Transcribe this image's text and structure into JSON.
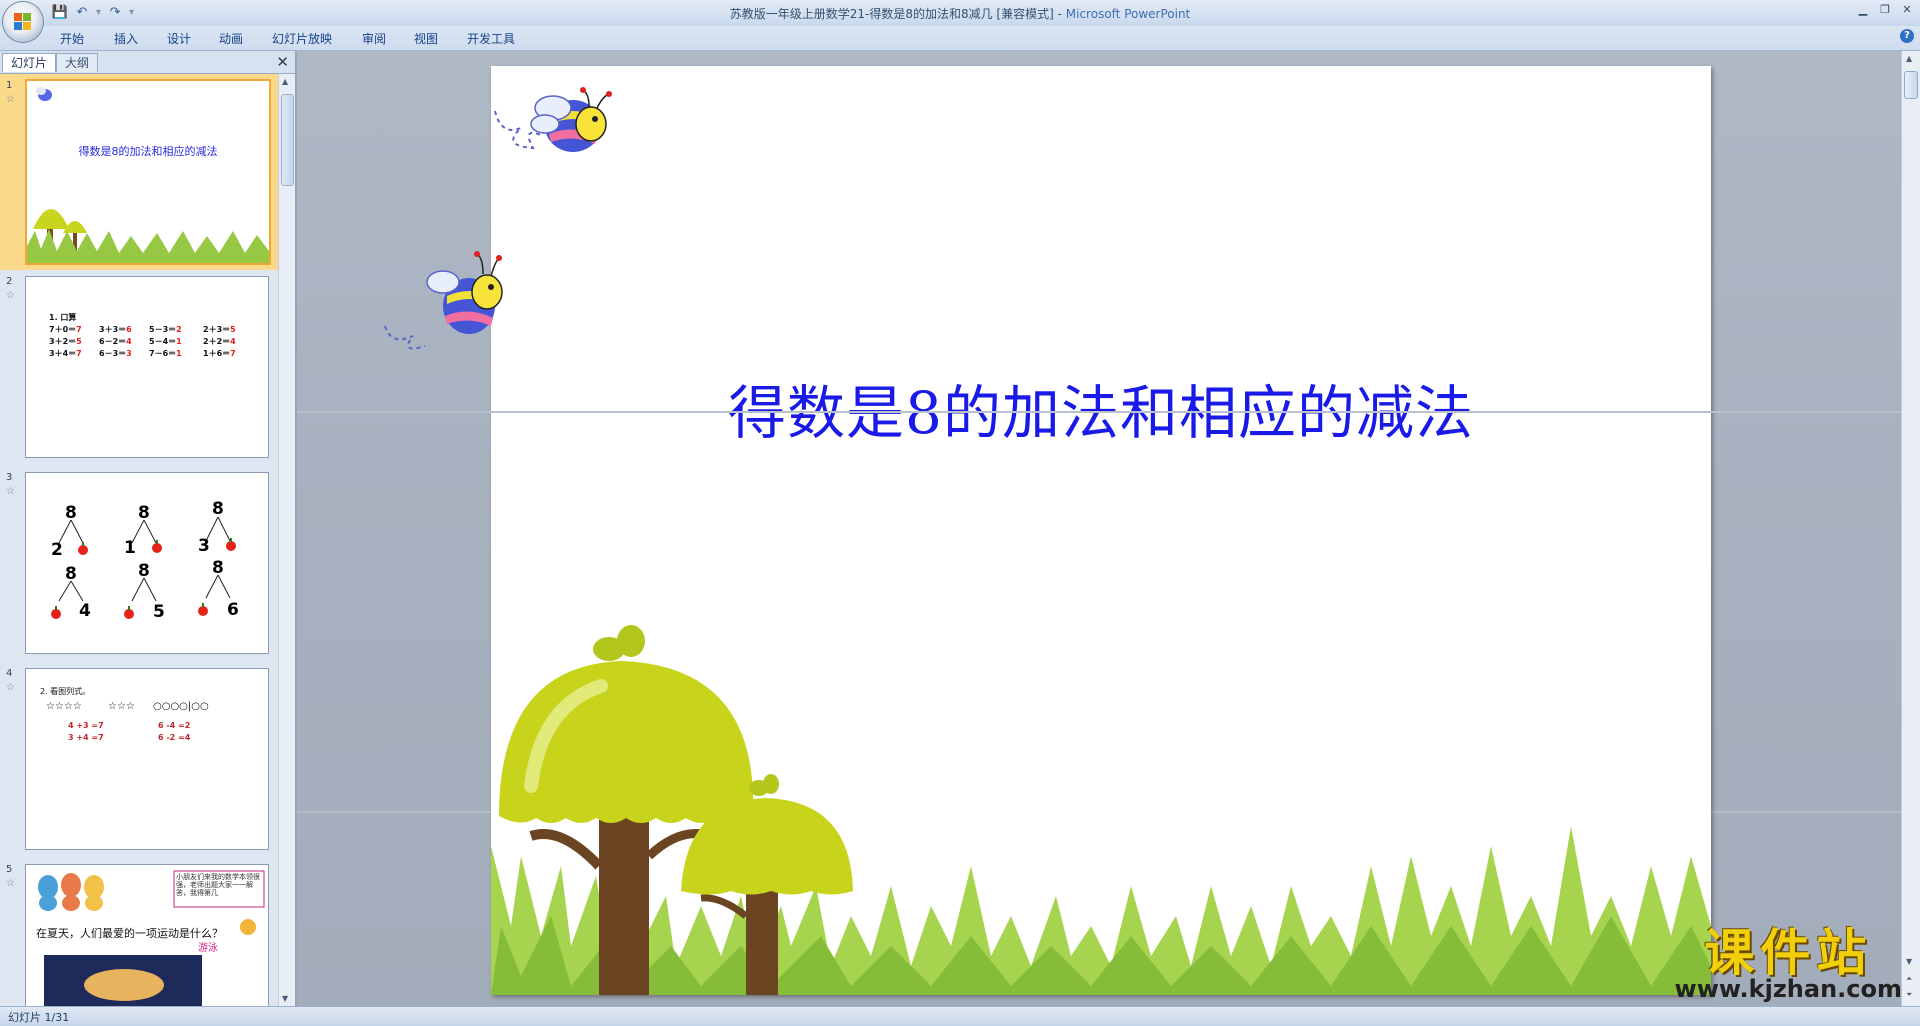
{
  "window": {
    "title_doc": "苏教版一年级上册数学21-得数是8的加法和8减几 [兼容模式]",
    "title_sep": " - ",
    "title_app": "Microsoft PowerPoint"
  },
  "ribbon": {
    "tabs": [
      "开始",
      "插入",
      "设计",
      "动画",
      "幻灯片放映",
      "审阅",
      "视图",
      "开发工具"
    ]
  },
  "left_pane": {
    "tab_slides": "幻灯片",
    "tab_outline": "大纲",
    "thumbs": [
      {
        "num": "1",
        "title": "得数是8的加法和相应的减法"
      },
      {
        "num": "2",
        "heading": "1. 口算",
        "rows": [
          [
            "7＋0＝",
            "7",
            "3＋3＝",
            "6",
            "5－3＝",
            "2",
            "2＋3＝",
            "5"
          ],
          [
            "3＋2＝",
            "5",
            "6－2＝",
            "4",
            "5－4＝",
            "1",
            "2＋2＝",
            "4"
          ],
          [
            "3＋4＝",
            "7",
            "6－3＝",
            "3",
            "7－6＝",
            "1",
            "1＋6＝",
            "7"
          ]
        ]
      },
      {
        "num": "3",
        "top_numbers": [
          "8",
          "8",
          "8"
        ],
        "upper_left": [
          "2",
          "1",
          "3"
        ],
        "mid_numbers": [
          "8",
          "8",
          "8"
        ],
        "lower_right": [
          "4",
          "5",
          "6"
        ]
      },
      {
        "num": "4",
        "heading": "2. 看图列式。",
        "stars_left": "☆☆☆☆",
        "stars_right": "☆☆☆",
        "circles": "○○○○|○○",
        "eq1": "4 +3 =7",
        "eq2": "3 +4 =7",
        "eq3": "6 -4 =2",
        "eq4": "6 -2 =4"
      },
      {
        "num": "5",
        "bubble": "小朋友们来我的数学本领很强，老师出题大家一一解答，我得第几",
        "question": "在夏天，人们最爱的一项运动是什么？",
        "answer": "游泳"
      }
    ]
  },
  "slide": {
    "title": "得数是8的加法和相应的减法"
  },
  "status": {
    "slide_info": "幻灯片 1/31"
  },
  "watermark": {
    "big": "课件站",
    "small": "www.kjzhan.com"
  },
  "colors": {
    "title_blue": "#1a1ae8",
    "apple_red": "#e4221a",
    "tree_yellow": "#c7d41c",
    "grass_green": "#8ec63f"
  }
}
